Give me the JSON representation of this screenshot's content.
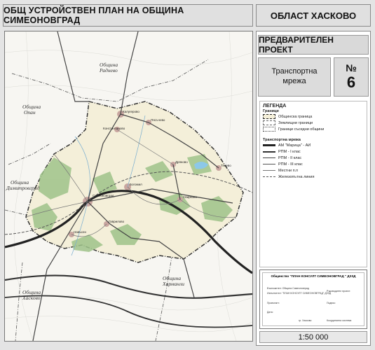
{
  "header": {
    "title": "ОБЩ УСТРОЙСТВЕН ПЛАН НА ОБЩИНА СИМЕОНОВГРАД",
    "region": "ОБЛАСТ ХАСКОВО"
  },
  "panel": {
    "stage": "ПРЕДВАРИТЕЛЕН ПРОЕКТ",
    "sheet_title_line1": "Транспортна",
    "sheet_title_line2": "мрежа",
    "sheet_number_label": "№",
    "sheet_number": "6",
    "scale": "1:50 000"
  },
  "legend": {
    "title": "ЛЕГЕНДА",
    "boundaries_heading": "Граници",
    "boundaries": [
      "Общинска граница",
      "Землищни граници",
      "Граници съседни общини"
    ],
    "transport_heading": "Транспортна мрежа",
    "transport": [
      "АМ \"Марица\" - АИ",
      "РПМ - I клас",
      "РПМ - II клас",
      "РПМ - III клас",
      "Местни п.п",
      "Железопътна линия"
    ]
  },
  "map_labels": {
    "neighbor_north": [
      "Община",
      "Раднево"
    ],
    "neighbor_west1": [
      "Община",
      "Опан"
    ],
    "neighbor_west2": [
      "Община",
      "Димитровград"
    ],
    "neighbor_south": [
      "Община",
      "Харманли"
    ],
    "neighbor_sw": [
      "Община",
      "Хасково"
    ],
    "towns": [
      "Симеоновград",
      "Калугерово",
      "Свирково",
      "Тянево",
      "Пясъчево",
      "Навъсен",
      "Константиново",
      "Богомил",
      "Дряново",
      "Гаврилово"
    ]
  },
  "stamp": {
    "company": "Общинство \"ПЛАН КОНСУЛТ СИМЕОНОВГРАД \" ДЗЗД",
    "rows": [
      "Възложител: Община Симеоновград",
      "Изпълнител: \"ПЛАН КОНСУЛТ СИМЕОНОВГРАД\" ДЗЗД",
      "Ръководител проект:",
      "Проектант:",
      "Подпис:",
      "Дата:",
      "гр. Хасково",
      "Координатна система"
    ]
  },
  "colors": {
    "municipality_fill": "#f4efd9",
    "forest": "#9fc38a",
    "settlement": "#c9a6a0",
    "water": "#8cc8e8",
    "road": "#333333",
    "panel_bg": "#e0e0e0"
  }
}
